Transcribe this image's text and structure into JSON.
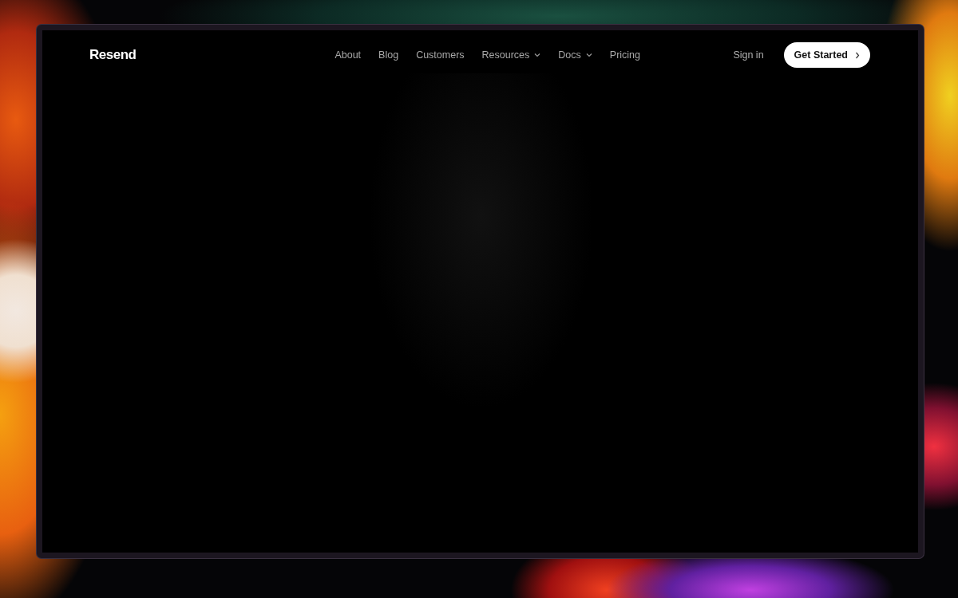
{
  "brand": {
    "name": "Resend"
  },
  "nav": [
    {
      "label": "About",
      "kind": "link"
    },
    {
      "label": "Blog",
      "kind": "link"
    },
    {
      "label": "Customers",
      "kind": "link"
    },
    {
      "label": "Resources",
      "kind": "dropdown"
    },
    {
      "label": "Docs",
      "kind": "dropdown"
    },
    {
      "label": "Pricing",
      "kind": "link"
    }
  ],
  "actions": {
    "sign_in": "Sign in",
    "cta": "Get Started"
  }
}
